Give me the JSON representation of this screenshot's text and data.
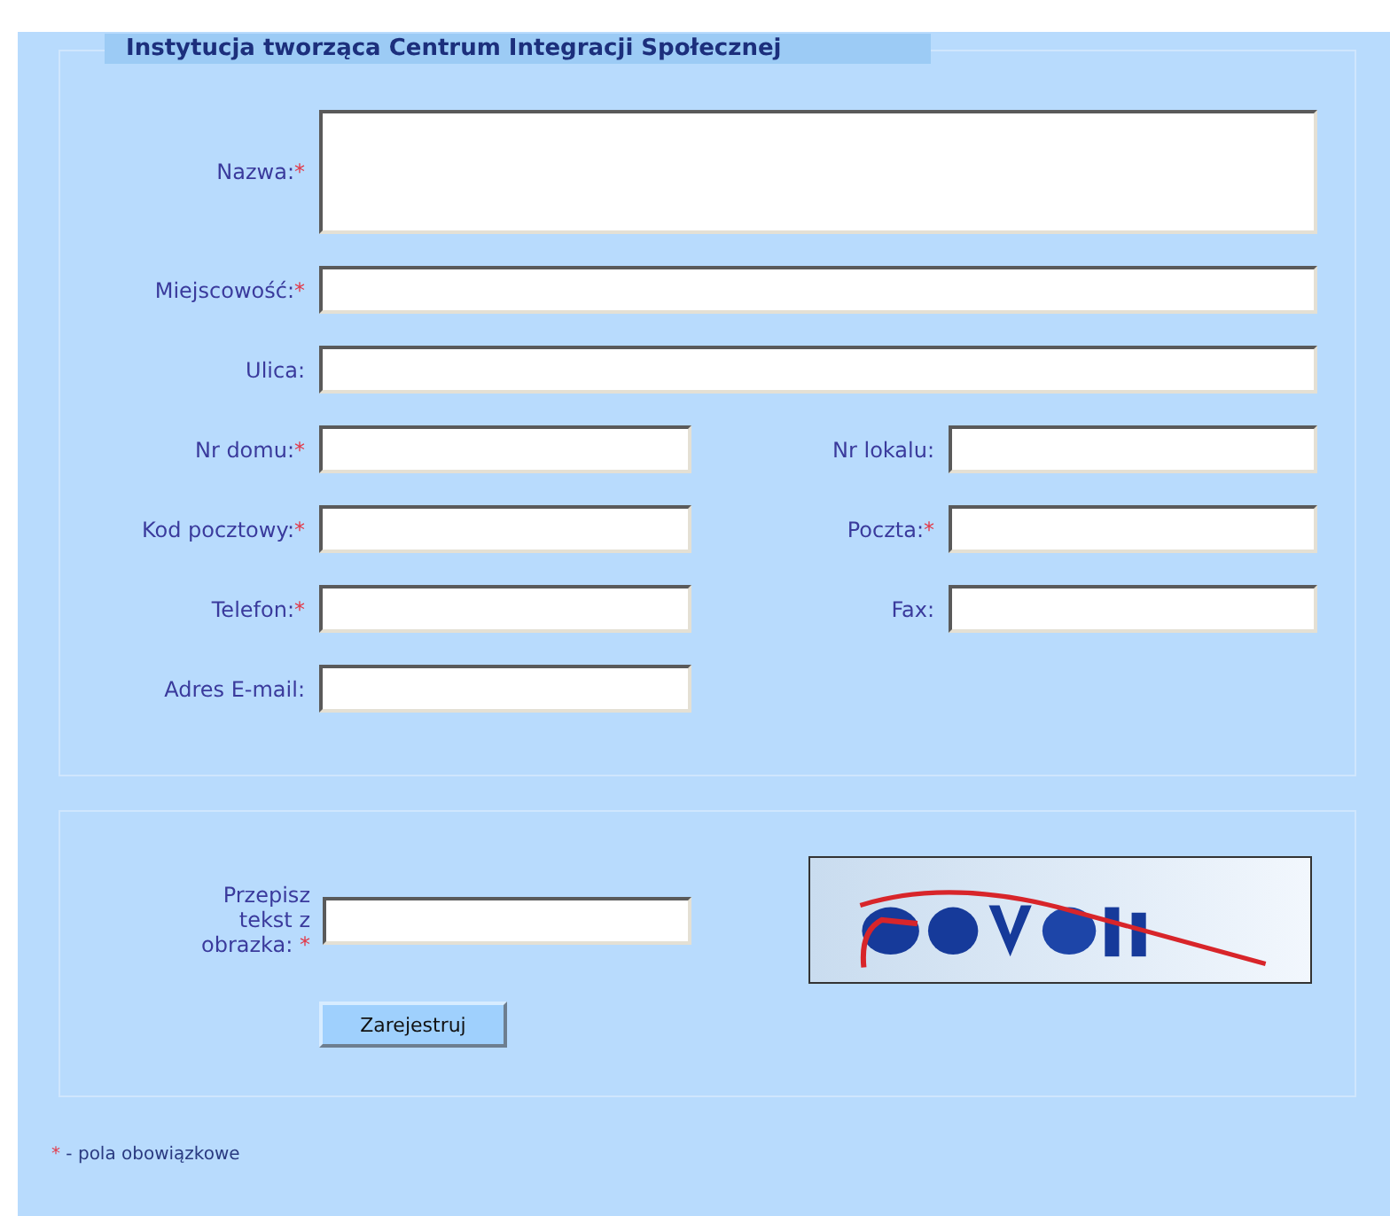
{
  "legend": "Instytucja tworząca Centrum Integracji Społecznej",
  "rows": [
    {
      "fields": [
        {
          "label": "Nazwa:",
          "mark": "*",
          "kind": "multiline"
        }
      ]
    },
    {
      "fields": [
        {
          "label": "Miejscowość:",
          "mark": "*",
          "kind": "wide"
        }
      ]
    },
    {
      "fields": [
        {
          "label": "Ulica:",
          "kind": "wide"
        }
      ]
    },
    {
      "fields": [
        {
          "label": "Nr domu:",
          "mark": "*",
          "kind": "short"
        },
        {
          "label": "Nr lokalu:",
          "kind": "short"
        }
      ]
    },
    {
      "fields": [
        {
          "label": "Kod pocztowy:",
          "mark": "*",
          "kind": "short"
        },
        {
          "label": "Poczta:",
          "mark": "*",
          "kind": "short"
        }
      ]
    },
    {
      "fields": [
        {
          "label": "Telefon:",
          "mark": "*",
          "kind": "short"
        },
        {
          "label": "Fax:",
          "kind": "short"
        }
      ]
    },
    {
      "fields": [
        {
          "label": "Adres E-mail:",
          "kind": "short"
        }
      ]
    }
  ],
  "captcha": {
    "label": "Przepisz tekst z obrazka:",
    "mark": "*"
  },
  "submit": "Zarejestruj",
  "footnote": {
    "mark": "*",
    "text": "- pola obowiązkowe"
  }
}
